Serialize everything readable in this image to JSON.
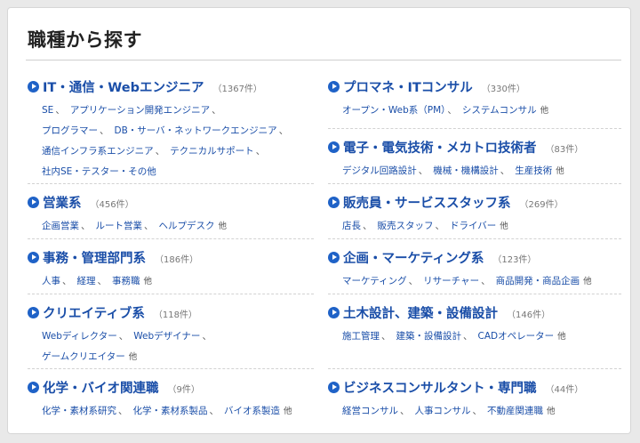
{
  "panel": {
    "title": "職種から探す"
  },
  "categories": [
    {
      "name": "IT・通信・Webエンジニア",
      "count": "（1367件）",
      "lines": [
        [
          "SE",
          "アプリケーション開発エンジニア"
        ],
        [
          "プログラマー",
          "DB・サーバ・ネットワークエンジニア"
        ],
        [
          "通信インフラ系エンジニア",
          "テクニカルサポート"
        ],
        [
          "社内SE・テスター・その他"
        ]
      ],
      "more": ""
    },
    {
      "name": "プロマネ・ITコンサル",
      "count": "（330件）",
      "lines": [
        [
          "オープン・Web系（PM）",
          "システムコンサル"
        ]
      ],
      "more": "他"
    },
    {
      "name": "電子・電気技術・メカトロ技術者",
      "count": "（83件）",
      "lines": [
        [
          "デジタル回路設計",
          "機械・機構設計",
          "生産技術"
        ]
      ],
      "more": "他"
    },
    {
      "name": "営業系",
      "count": "（456件）",
      "lines": [
        [
          "企画営業",
          "ルート営業",
          "ヘルプデスク"
        ]
      ],
      "more": "他"
    },
    {
      "name": "販売員・サービススタッフ系",
      "count": "（269件）",
      "lines": [
        [
          "店長",
          "販売スタッフ",
          "ドライバー"
        ]
      ],
      "more": "他"
    },
    {
      "name": "事務・管理部門系",
      "count": "（186件）",
      "lines": [
        [
          "人事",
          "経理",
          "事務職"
        ]
      ],
      "more": "他"
    },
    {
      "name": "企画・マーケティング系",
      "count": "（123件）",
      "lines": [
        [
          "マーケティング",
          "リサーチャー",
          "商品開発・商品企画"
        ]
      ],
      "more": "他"
    },
    {
      "name": "クリエイティブ系",
      "count": "（118件）",
      "lines": [
        [
          "Webディレクター",
          "Webデザイナー",
          ""
        ],
        [
          "ゲームクリエイター"
        ]
      ],
      "more": "他"
    },
    {
      "name": "土木設計、建築・設備設計",
      "count": "（146件）",
      "lines": [
        [
          "施工管理",
          "建築・設備設計",
          "CADオペレーター"
        ]
      ],
      "more": "他"
    },
    {
      "name": "化学・バイオ関連職",
      "count": "（9件）",
      "lines": [
        [
          "化学・素材系研究",
          "化学・素材系製品",
          "バイオ系製造"
        ]
      ],
      "more": "他"
    },
    {
      "name": "ビジネスコンサルタント・専門職",
      "count": "（44件）",
      "lines": [
        [
          "経営コンサル",
          "人事コンサル",
          "不動産関連職"
        ]
      ],
      "more": "他"
    }
  ]
}
